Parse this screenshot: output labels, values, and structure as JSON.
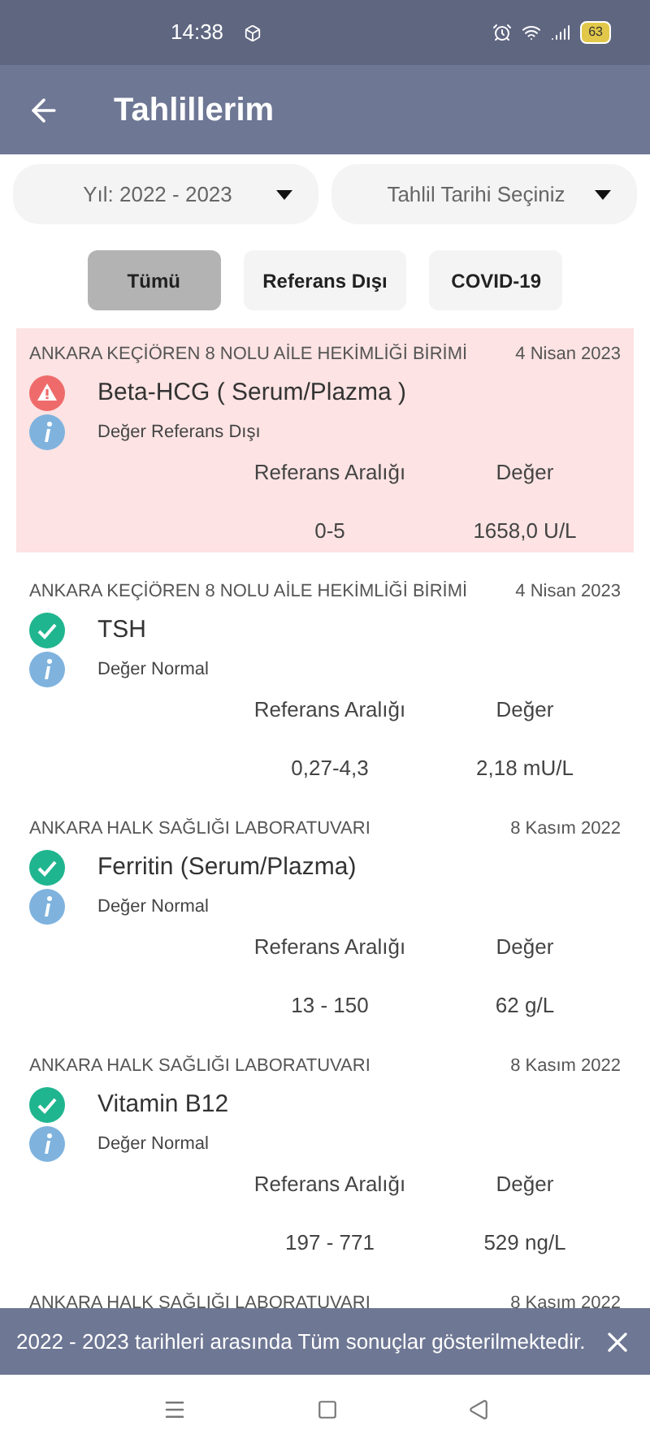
{
  "status_bar": {
    "time": "14:38",
    "battery": "63"
  },
  "header": {
    "title": "Tahlillerim"
  },
  "filters": [
    {
      "label": "Yıl: 2022 - 2023"
    },
    {
      "label": "Tahlil Tarihi Seçiniz"
    }
  ],
  "tabs": [
    {
      "label": "Tümü",
      "selected": true
    },
    {
      "label": "Referans Dışı",
      "selected": false
    },
    {
      "label": "COVID-19",
      "selected": false
    }
  ],
  "results": [
    {
      "lab": "ANKARA KEÇİÖREN 8 NOLU AİLE HEKİMLİĞİ BİRİMİ",
      "date": "4 Nisan 2023",
      "test": "Beta-HCG ( Serum/Plazma )",
      "kind": "abnormal",
      "note": "Değer Referans Dışı",
      "range_label": "Referans Aralığı",
      "value_label": "Değer",
      "range": "0-5",
      "value": "1658,0 U/L"
    },
    {
      "lab": "ANKARA KEÇİÖREN 8 NOLU AİLE HEKİMLİĞİ BİRİMİ",
      "date": "4 Nisan 2023",
      "test": "TSH",
      "kind": "normal",
      "note": "Değer Normal",
      "range_label": "Referans Aralığı",
      "value_label": "Değer",
      "range": "0,27-4,3",
      "value": "2,18 mU/L"
    },
    {
      "lab": "ANKARA HALK SAĞLIĞI LABORATUVARI",
      "date": "8 Kasım 2022",
      "test": "Ferritin (Serum/Plazma)",
      "kind": "normal",
      "note": "Değer Normal",
      "range_label": "Referans Aralığı",
      "value_label": "Değer",
      "range": "13 - 150",
      "value": "62 g/L"
    },
    {
      "lab": "ANKARA HALK SAĞLIĞI LABORATUVARI",
      "date": "8 Kasım 2022",
      "test": "Vitamin B12",
      "kind": "normal",
      "note": "Değer Normal",
      "range_label": "Referans Aralığı",
      "value_label": "Değer",
      "range": "197 - 771",
      "value": "529 ng/L"
    },
    {
      "lab": "ANKARA HALK SAĞLIĞI LABORATUVARI",
      "date": "8 Kasım 2022"
    }
  ],
  "snackbar": {
    "message": "2022 - 2023 tarihleri arasında Tüm sonuçlar gösterilmektedir."
  }
}
